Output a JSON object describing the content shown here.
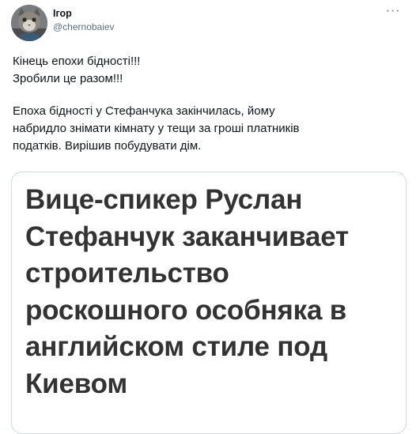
{
  "author": {
    "name": "Ігор",
    "handle": "@chernobaiev"
  },
  "menu": {
    "more_label": "···"
  },
  "tweet": {
    "lines": [
      "Кінець епохи бідності!!!",
      "Зробили це разом!!!",
      "Епоха бідності у Стефанчука закінчилась, йому",
      "набридло знімати кімнату у тещи за гроші платників",
      "податків. Вирішив побудувати дім."
    ]
  },
  "media": {
    "headline_lines": [
      "Вице-спикер Руслан",
      "Стефанчук заканчивает",
      "строительство",
      "роскошного особняка в",
      "английском стиле под",
      "Киевом"
    ]
  },
  "colors": {
    "text": "#0f1419",
    "secondary": "#5b7083",
    "border": "#cfd9de",
    "headline": "#333333"
  },
  "icons": {
    "avatar": "cat-avatar-icon",
    "more": "more-dots-icon"
  }
}
